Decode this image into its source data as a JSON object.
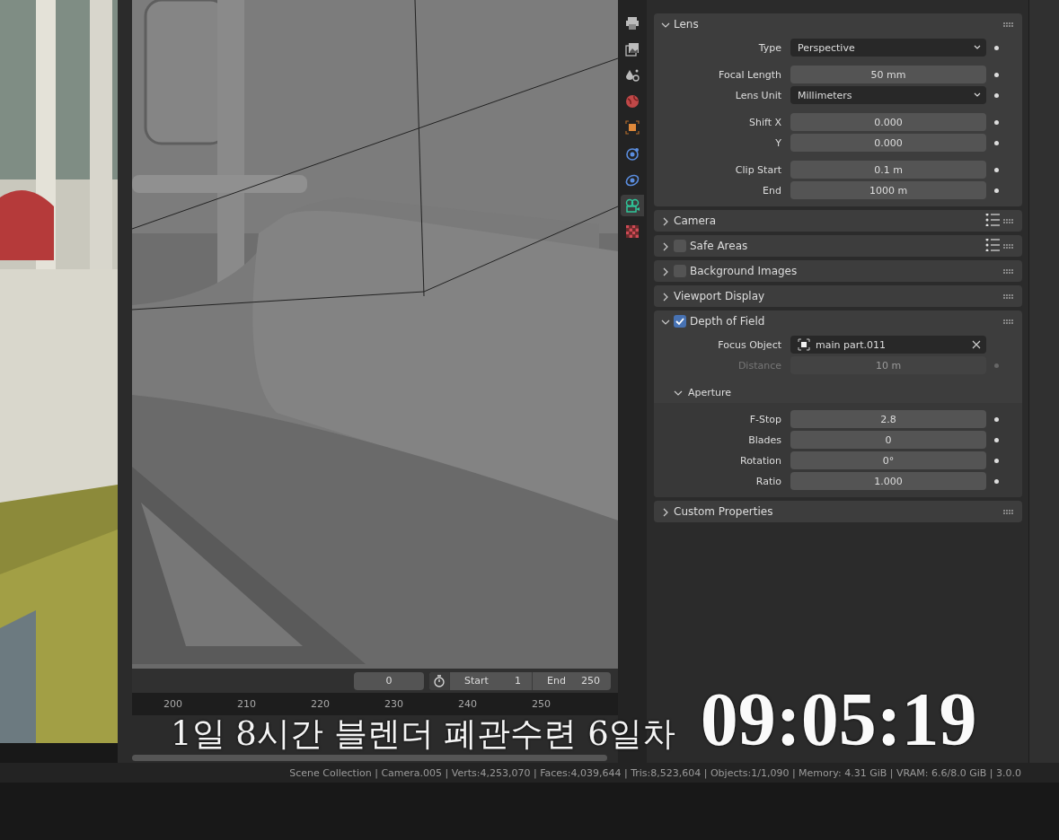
{
  "sidebar": {
    "tabs": [
      {
        "kind": "output",
        "selected": false
      },
      {
        "kind": "view-layer",
        "selected": false
      },
      {
        "kind": "scene",
        "selected": false
      },
      {
        "kind": "world",
        "selected": false
      },
      {
        "kind": "object",
        "selected": false
      },
      {
        "kind": "physics",
        "selected": false
      },
      {
        "kind": "constraints",
        "selected": false
      },
      {
        "kind": "camera",
        "selected": true
      },
      {
        "kind": "texture",
        "selected": false
      }
    ]
  },
  "sections": [
    {
      "title": "Lens",
      "expanded": true,
      "presets": false,
      "groups": [
        [
          {
            "label": "Type",
            "value": "Perspective",
            "kind": "dropdown",
            "disabled": false,
            "keyframe_dot": true
          }
        ],
        [
          {
            "label": "Focal Length",
            "value": "50 mm",
            "kind": "number",
            "disabled": false,
            "keyframe_dot": true
          },
          {
            "label": "Lens Unit",
            "value": "Millimeters",
            "kind": "dropdown",
            "disabled": false,
            "keyframe_dot": true
          }
        ],
        [
          {
            "label": "Shift X",
            "value": "0.000",
            "kind": "number",
            "disabled": false,
            "keyframe_dot": true
          },
          {
            "label": "Y",
            "value": "0.000",
            "kind": "number",
            "disabled": false,
            "keyframe_dot": true
          }
        ],
        [
          {
            "label": "Clip Start",
            "value": "0.1 m",
            "kind": "number",
            "disabled": false,
            "keyframe_dot": true
          },
          {
            "label": "End",
            "value": "1000 m",
            "kind": "number",
            "disabled": false,
            "keyframe_dot": true
          }
        ]
      ]
    },
    {
      "title": "Camera",
      "expanded": false,
      "presets": true
    },
    {
      "title": "Safe Areas",
      "expanded": false,
      "checked": false,
      "presets": true
    },
    {
      "title": "Background Images",
      "expanded": false,
      "checked": false,
      "presets": false
    },
    {
      "title": "Viewport Display",
      "expanded": false,
      "presets": false
    },
    {
      "title": "Depth of Field",
      "expanded": true,
      "checked": true,
      "presets": false,
      "groups": [
        [
          {
            "label": "Focus Object",
            "value": "main part.011",
            "kind": "object",
            "disabled": false,
            "keyframe_dot": false
          },
          {
            "label": "Distance",
            "value": "10 m",
            "kind": "number",
            "disabled": true,
            "keyframe_dot": true
          }
        ]
      ],
      "subsections": [
        {
          "title": "Aperture",
          "expanded": true,
          "groups": [
            [
              {
                "label": "F-Stop",
                "value": "2.8",
                "kind": "number",
                "disabled": false,
                "keyframe_dot": true
              },
              {
                "label": "Blades",
                "value": "0",
                "kind": "number",
                "disabled": false,
                "keyframe_dot": true
              },
              {
                "label": "Rotation",
                "value": "0°",
                "kind": "number",
                "disabled": false,
                "keyframe_dot": true
              },
              {
                "label": "Ratio",
                "value": "1.000",
                "kind": "number",
                "disabled": false,
                "keyframe_dot": true
              }
            ]
          ]
        }
      ]
    },
    {
      "title": "Custom Properties",
      "expanded": false,
      "presets": false
    }
  ],
  "timeline": {
    "current_frame": "0",
    "start_label": "Start",
    "start": "1",
    "end_label": "End",
    "end": "250",
    "ticks": [
      "200",
      "210",
      "220",
      "230",
      "240",
      "250"
    ]
  },
  "overlay": {
    "caption": "1일 8시간 블렌더 폐관수련 6일차",
    "timer": "09:05:19"
  },
  "status_bar": "Scene Collection | Camera.005 | Verts:4,253,070 | Faces:4,039,644 | Tris:8,523,604 | Objects:1/1,090 | Memory: 4.31 GiB | VRAM: 6.6/8.0 GiB | 3.0.0"
}
